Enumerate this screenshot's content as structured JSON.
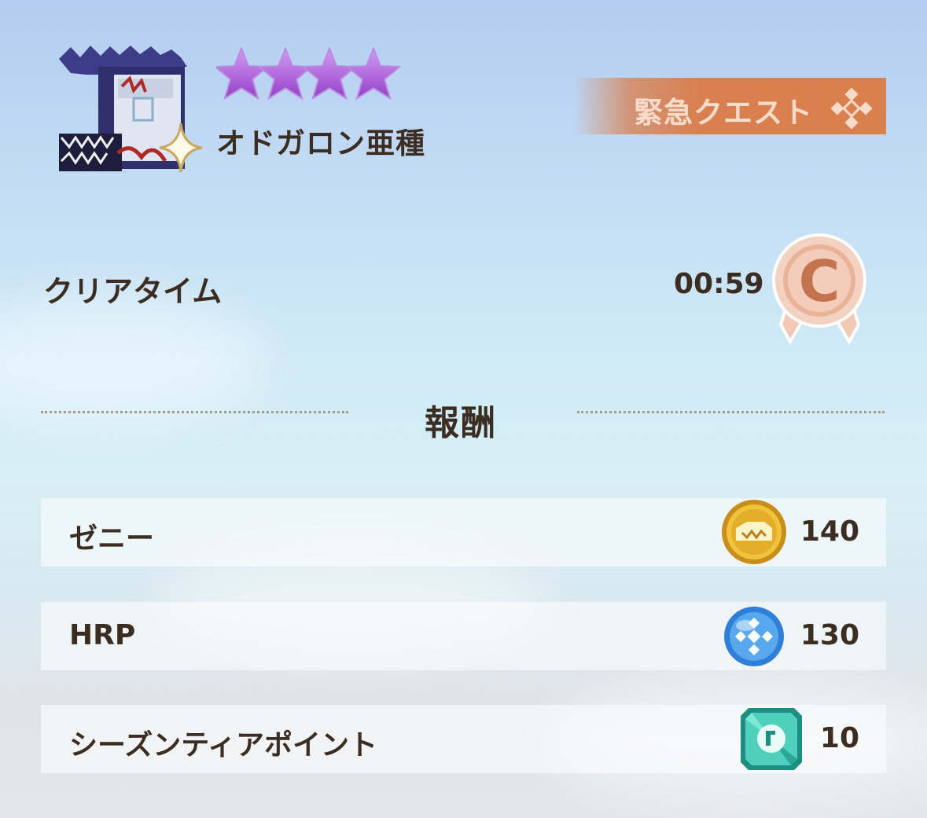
{
  "quest": {
    "monster_name": "オドガロン亜種",
    "star_rating": 4,
    "urgent_label": "緊急クエスト"
  },
  "clear": {
    "label": "クリアタイム",
    "time": "00:59",
    "rank": "C"
  },
  "rewards": {
    "title": "報酬",
    "items": [
      {
        "label": "ゼニー",
        "value": "140",
        "icon": "zenny-coin-icon"
      },
      {
        "label": "HRP",
        "value": "130",
        "icon": "hrp-orb-icon"
      },
      {
        "label": "シーズンティアポイント",
        "value": "10",
        "icon": "season-tier-gem-icon"
      }
    ]
  },
  "colors": {
    "star": "#a65ad6",
    "banner": "#da7f4e",
    "rank_badge": "#e7a98a",
    "text": "#3b2d22"
  }
}
